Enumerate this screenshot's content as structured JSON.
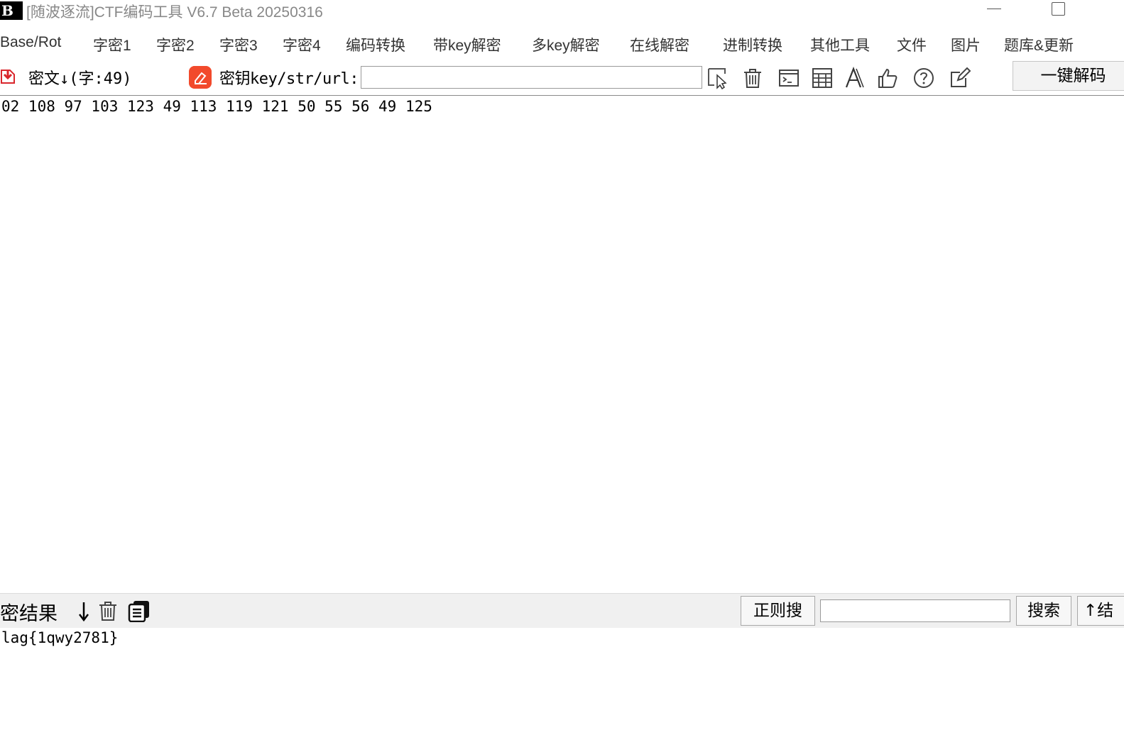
{
  "window": {
    "logo_text": "B",
    "title": "[随波逐流]CTF编码工具 V6.7 Beta 20250316"
  },
  "menu": [
    {
      "label": "Base/Rot"
    },
    {
      "label": "字密1"
    },
    {
      "label": "字密2"
    },
    {
      "label": "字密3"
    },
    {
      "label": "字密4"
    },
    {
      "label": "编码转换"
    },
    {
      "label": "带key解密"
    },
    {
      "label": "多key解密"
    },
    {
      "label": "在线解密"
    },
    {
      "label": "进制转换"
    },
    {
      "label": "其他工具"
    },
    {
      "label": "文件"
    },
    {
      "label": "图片"
    },
    {
      "label": "题库&更新"
    }
  ],
  "toolbar": {
    "cipher_label": "密文↓(字:49)",
    "key_label": "密钥key/str/url:",
    "key_value": "",
    "decode_button": "一键解码",
    "icons": [
      "pointer-icon",
      "trash-icon",
      "terminal-icon",
      "calculator-icon",
      "font-icon",
      "thumbs-up-icon",
      "help-icon",
      "edit-icon"
    ]
  },
  "cipher": {
    "text": "02 108 97 103 123 49 113 119 121 50 55 56 49 125"
  },
  "result_bar": {
    "label": "解密结果",
    "regex_button": "正则搜",
    "search_value": "",
    "search_button": "搜索",
    "up_button": "↑结"
  },
  "result": {
    "text": "lag{1qwy2781}"
  },
  "colors": {
    "key_icon": "#f24a2c",
    "cipher_icon": "#d9262c"
  }
}
